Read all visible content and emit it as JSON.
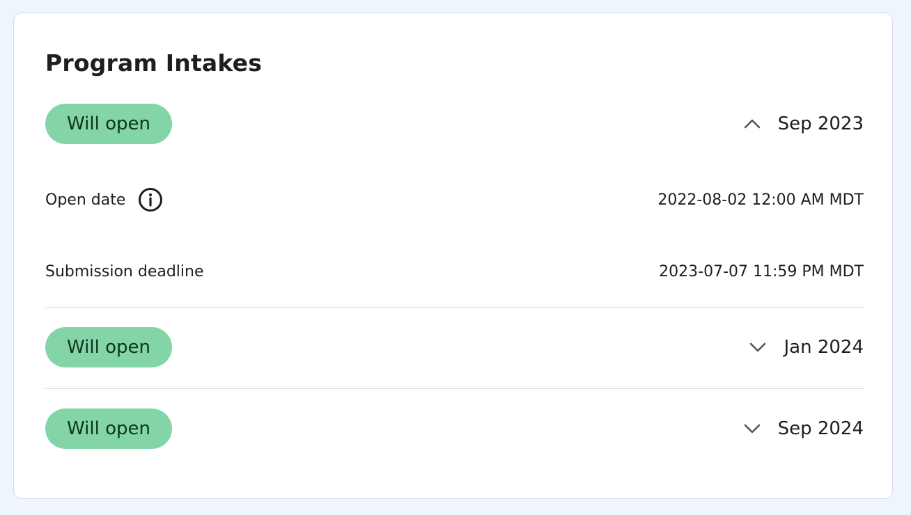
{
  "page": {
    "title": "Program Intakes"
  },
  "intakes": [
    {
      "status": "Will open",
      "term": "Sep 2023",
      "expanded": true,
      "details": {
        "open_date_label": "Open date",
        "open_date_value": "2022-08-02 12:00 AM MDT",
        "deadline_label": "Submission deadline",
        "deadline_value": "2023-07-07 11:59 PM MDT"
      }
    },
    {
      "status": "Will open",
      "term": "Jan 2024",
      "expanded": false
    },
    {
      "status": "Will open",
      "term": "Sep 2024",
      "expanded": false
    }
  ],
  "icons": {
    "expanded": "chevron-up-icon",
    "collapsed": "chevron-down-icon",
    "info": "info-icon"
  },
  "colors": {
    "page_background": "#eff5fd",
    "badge_background": "#83d5a8",
    "badge_text": "#10331f",
    "divider": "#d9d9d9"
  }
}
